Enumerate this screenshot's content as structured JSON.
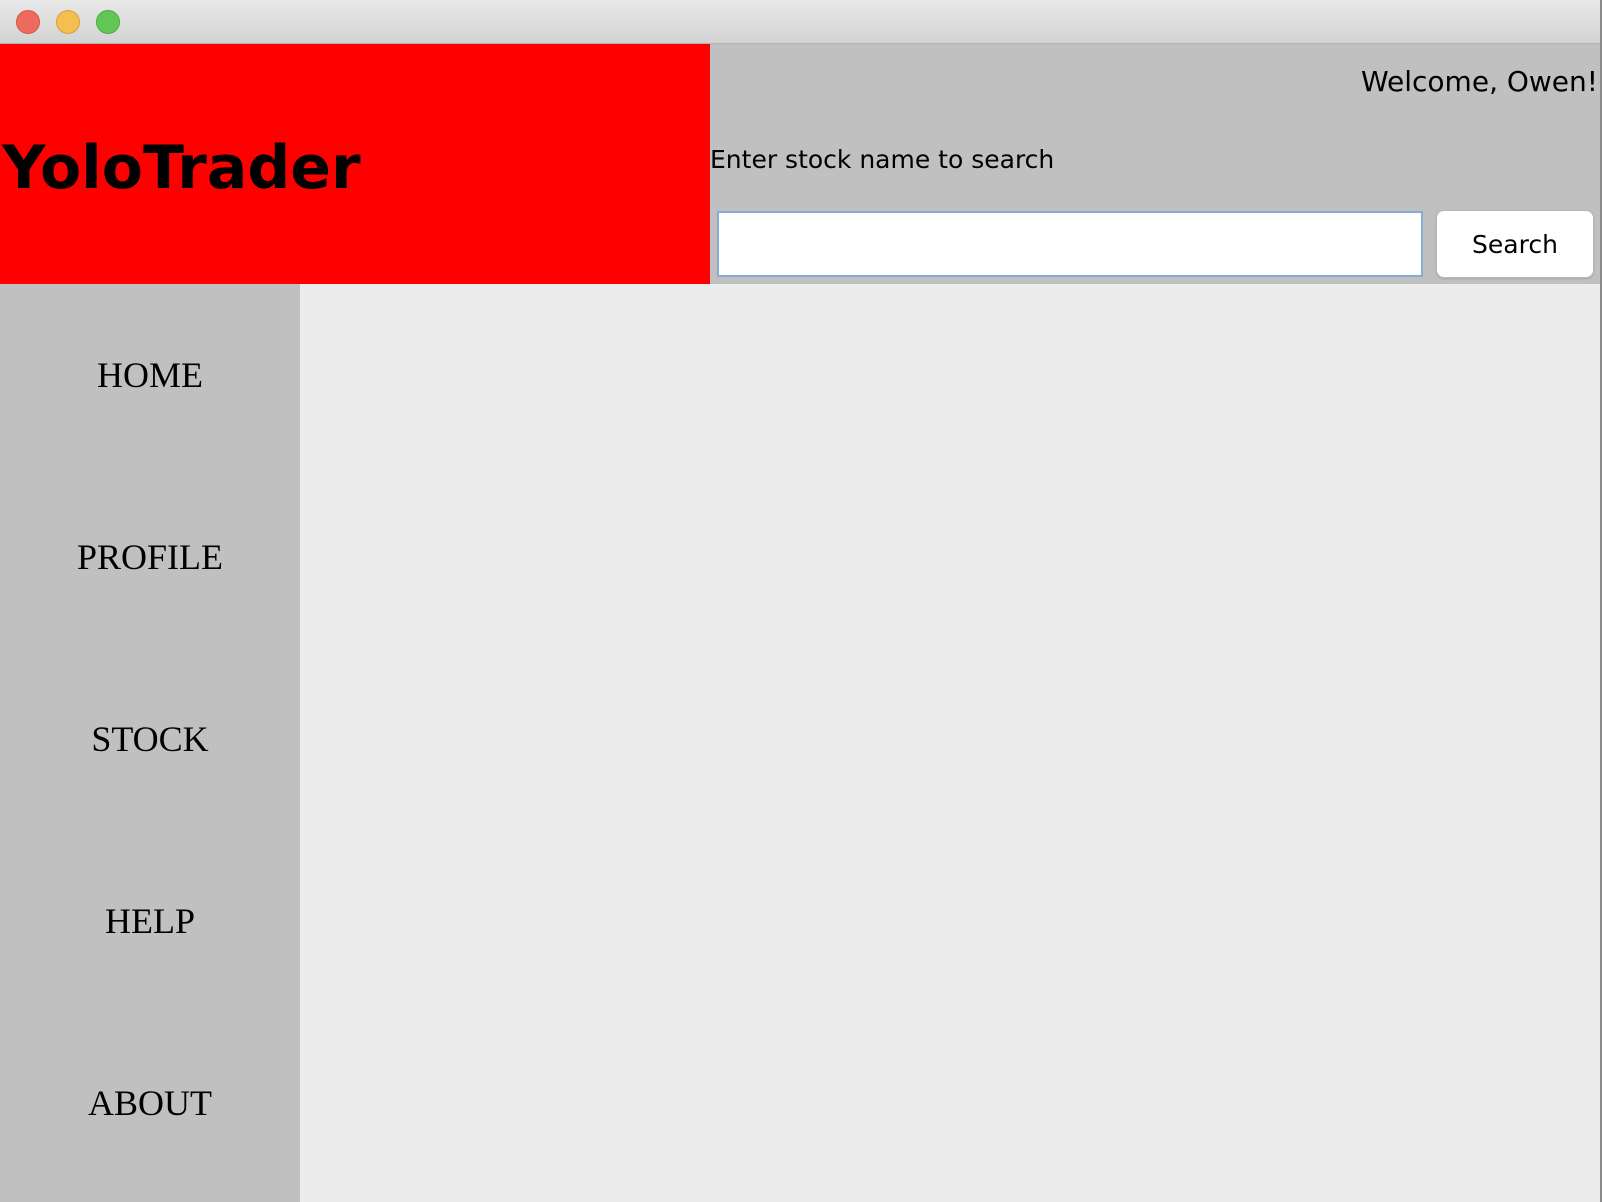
{
  "app": {
    "brand_title": "YoloTrader",
    "welcome_text": "Welcome, Owen!"
  },
  "search": {
    "label": "Enter stock name to search",
    "value": "",
    "placeholder": "",
    "button_label": "Search"
  },
  "sidebar": {
    "items": [
      {
        "label": "HOME"
      },
      {
        "label": "PROFILE"
      },
      {
        "label": "STOCK"
      },
      {
        "label": "HELP"
      },
      {
        "label": "ABOUT"
      }
    ]
  },
  "colors": {
    "brand_background": "#ff0000",
    "panel_background": "#c0c0c0",
    "content_background": "#ececec",
    "close_button": "#ee6a5e",
    "minimize_button": "#f5bf4f",
    "zoom_button": "#62c655"
  },
  "icons": {
    "close": "close-window-icon",
    "minimize": "minimize-window-icon",
    "zoom": "zoom-window-icon"
  }
}
